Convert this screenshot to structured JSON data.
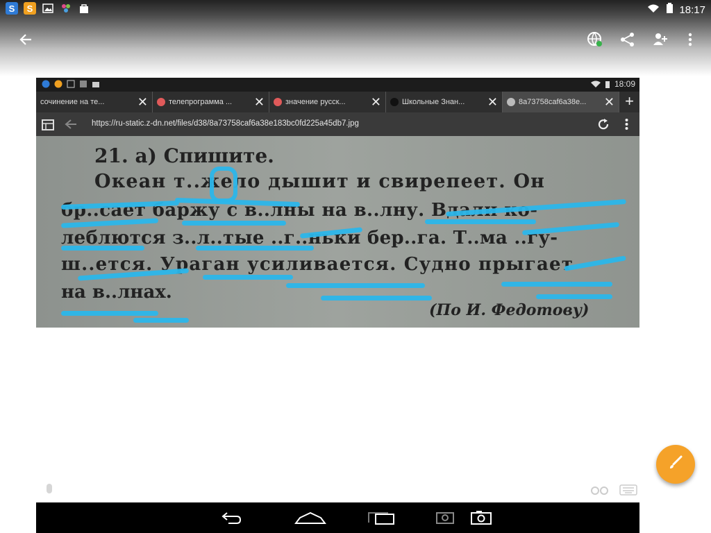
{
  "status_bar": {
    "time": "18:17",
    "left_icons": [
      "s-app-icon",
      "s-app-icon-orange",
      "image-icon",
      "app-icon",
      "bag-icon"
    ]
  },
  "action_bar": {
    "back": "back-arrow-icon",
    "actions": [
      "translate-icon",
      "share-icon",
      "person-add-icon",
      "more-vert-icon"
    ]
  },
  "photo": {
    "status_time": "18:09",
    "tabs": [
      {
        "label": "сочинение на те...",
        "color": "#e05a5a"
      },
      {
        "label": "телепрограмма ...",
        "color": "#e05a5a"
      },
      {
        "label": "значение русск...",
        "color": "#e05a5a"
      },
      {
        "label": "Школьные Знан...",
        "color": "#222222"
      },
      {
        "label": "8a73758caf6a38e...",
        "color": "#bbbbbb"
      }
    ],
    "url": "https://ru-static.z-dn.net/files/d38/8a73758caf6a38e183bc0fd225a45db7.jpg",
    "page_lines": [
      "21. а) Спишите.",
      "Океан т..жело дышит и свирепеет. Он",
      "бр..сает баржу с в..лны на в..лну. Вдали ко-",
      "леблются з..л..тые ..г..ньки бер..га. Т..ма ..гу-",
      "ш..ется. Ураган усиливается. Судно прыгает",
      "на в..лнах.",
      "(По И. Федотову)"
    ]
  },
  "fab": {
    "icon": "brush-icon"
  },
  "bottom_icons": [
    "mic-icon",
    "handwriting-icon",
    "keyboard-icon"
  ],
  "navbar": [
    "back-nav-icon",
    "home-nav-icon",
    "recents-nav-icon",
    "screenshot-nav-icon",
    "camera-nav-icon"
  ],
  "colors": {
    "highlight": "#2bb6ea",
    "fab": "#f5a229"
  }
}
